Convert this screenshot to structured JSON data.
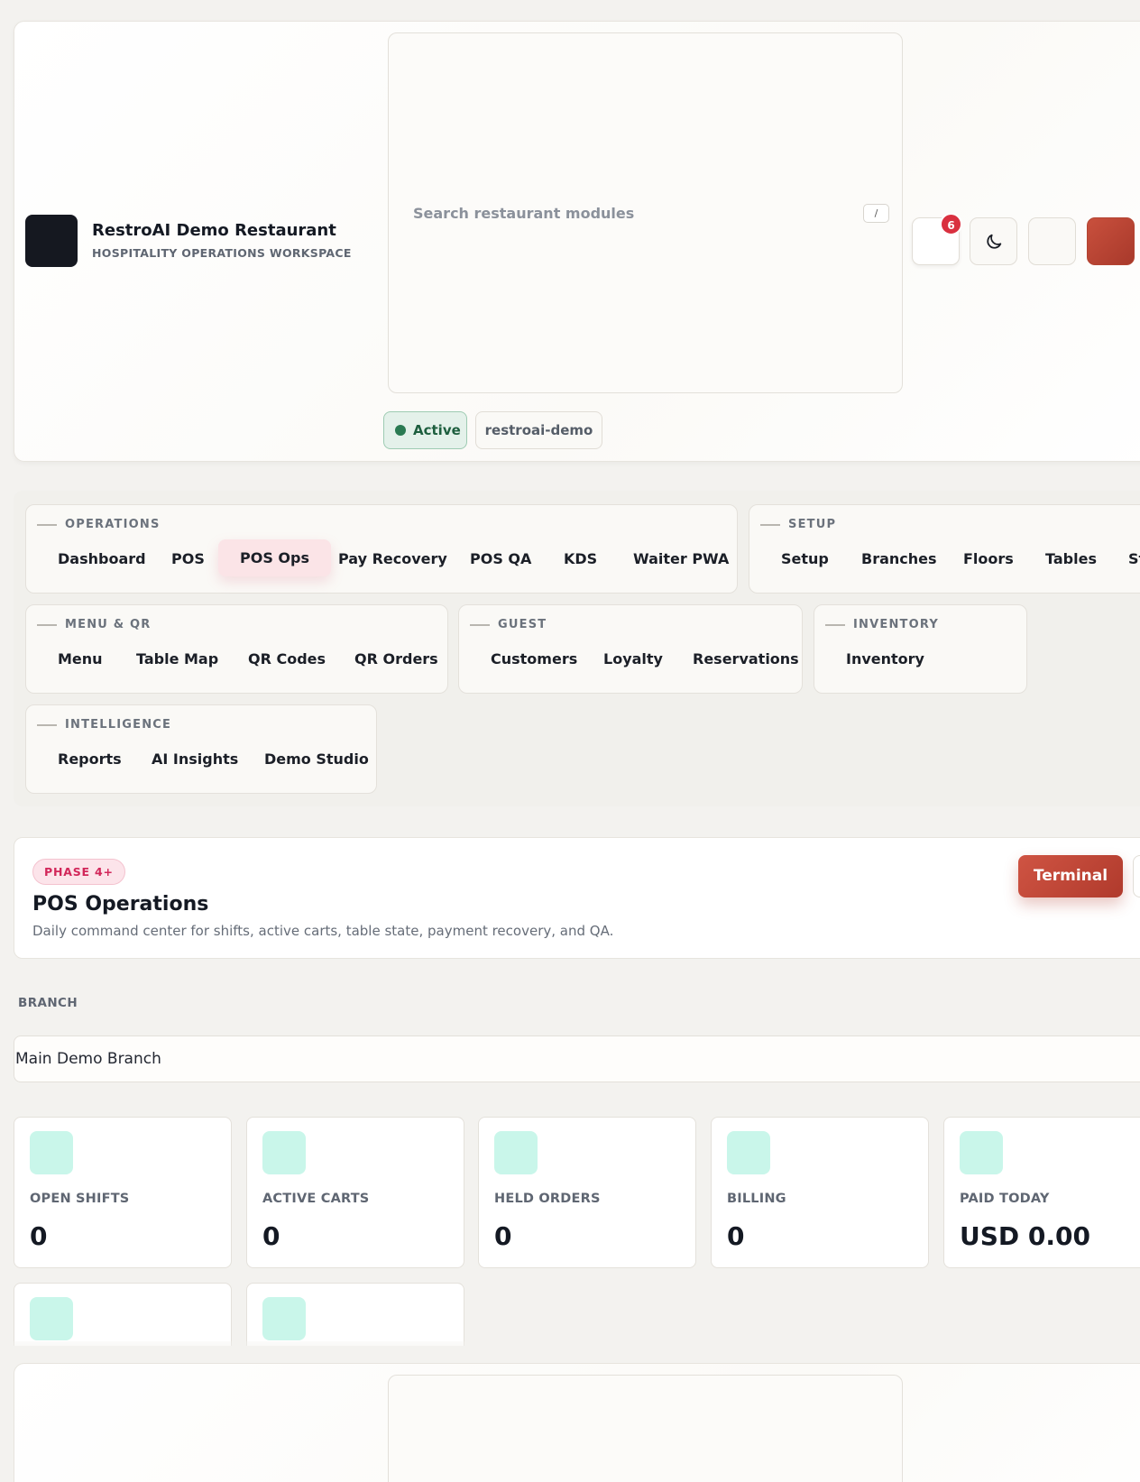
{
  "header": {
    "brand_title": "RestroAI Demo Restaurant",
    "brand_subtitle": "HOSPITALITY OPERATIONS WORKSPACE",
    "search_placeholder": "Search restaurant modules",
    "search_shortcut": "/",
    "notification_count": "6",
    "status_label": "Active",
    "tenant_slug": "restroai-demo",
    "icons": [
      "bell-icon",
      "moon-icon",
      "settings-icon",
      "profile-icon"
    ]
  },
  "nav": {
    "operations": {
      "title": "OPERATIONS",
      "items": [
        "Dashboard",
        "POS",
        "POS Ops",
        "Pay Recovery",
        "POS QA",
        "KDS",
        "Waiter PWA"
      ],
      "selected": "POS Ops"
    },
    "setup": {
      "title": "SETUP",
      "items": [
        "Setup",
        "Branches",
        "Floors",
        "Tables",
        "St"
      ]
    },
    "menu_qr": {
      "title": "MENU & QR",
      "items": [
        "Menu",
        "Table Map",
        "QR Codes",
        "QR Orders"
      ]
    },
    "guest": {
      "title": "GUEST",
      "items": [
        "Customers",
        "Loyalty",
        "Reservations"
      ]
    },
    "inventory": {
      "title": "INVENTORY",
      "items": [
        "Inventory"
      ]
    },
    "intelligence": {
      "title": "INTELLIGENCE",
      "items": [
        "Reports",
        "AI Insights",
        "Demo Studio"
      ]
    }
  },
  "page": {
    "badge": "PHASE 4+",
    "title": "POS Operations",
    "description": "Daily command center for shifts, active carts, table state, payment recovery, and QA.",
    "primary_action": "Terminal"
  },
  "branch": {
    "label": "BRANCH",
    "selected": "Main Demo Branch"
  },
  "stats": [
    {
      "label": "OPEN SHIFTS",
      "value": "0"
    },
    {
      "label": "ACTIVE CARTS",
      "value": "0"
    },
    {
      "label": "HELD ORDERS",
      "value": "0"
    },
    {
      "label": "BILLING",
      "value": "0"
    },
    {
      "label": "PAID TODAY",
      "value": "USD 0.00"
    }
  ],
  "colors": {
    "accent_red": "#b03a2c",
    "selected_nav_bg": "#fbe4e7",
    "stat_icon_bg": "#c9f6ea",
    "active_green": "#2a7a52",
    "badge_pink": "#d2275a"
  }
}
